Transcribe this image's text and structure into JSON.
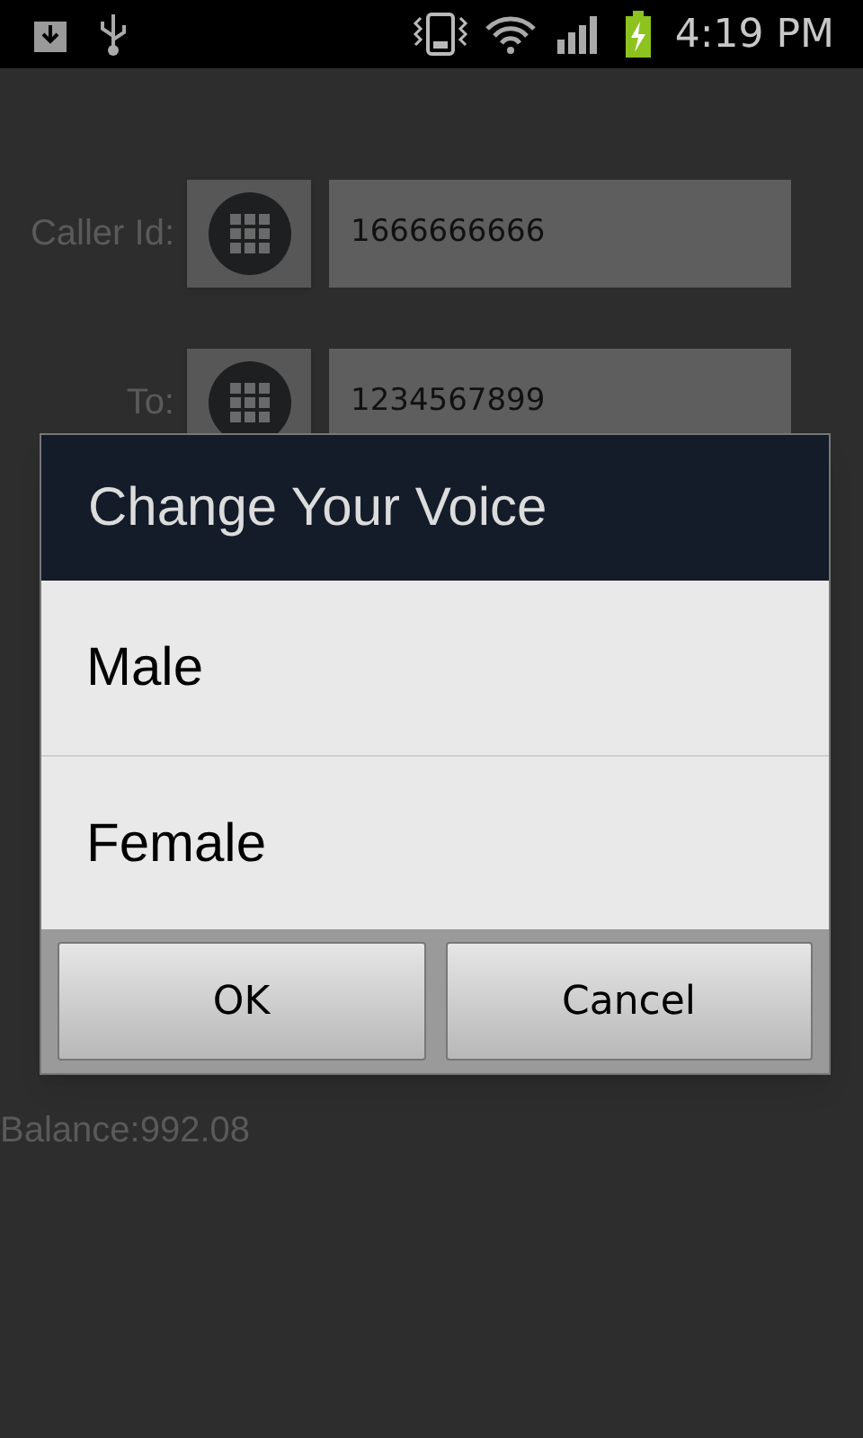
{
  "status_bar": {
    "time": "4:19 PM"
  },
  "form": {
    "rows": [
      {
        "label": "Caller Id:",
        "value": "1666666666"
      },
      {
        "label": "To:",
        "value": "1234567899"
      }
    ],
    "balance": "Balance:992.08"
  },
  "dialog": {
    "title": "Change Your Voice",
    "options": [
      "Male",
      "Female"
    ],
    "buttons": [
      "OK",
      "Cancel"
    ]
  }
}
